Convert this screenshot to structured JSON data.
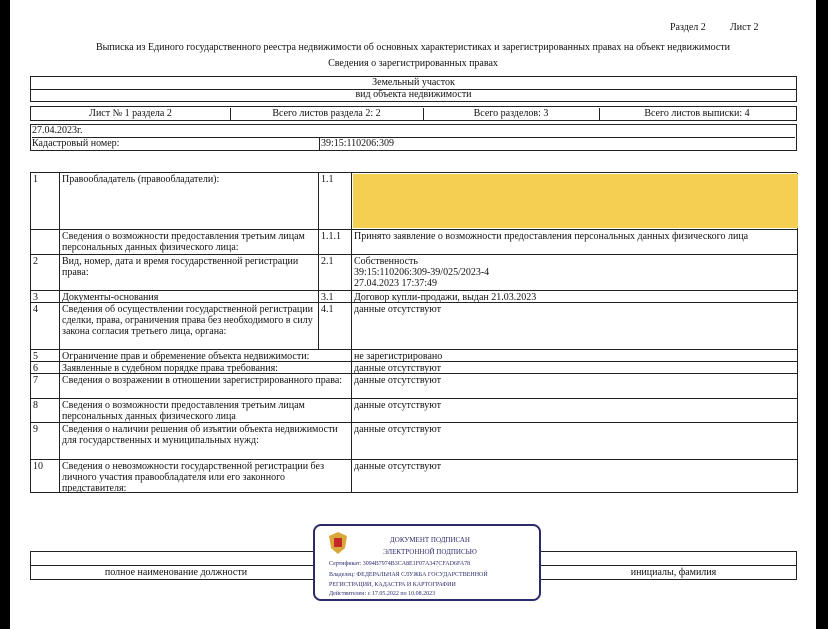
{
  "header": {
    "section": "Раздел 2",
    "sheet": "Лист 2",
    "title": "Выписка из Единого государственного реестра недвижимости об основных характеристиках и зарегистрированных правах на объект недвижимости",
    "subtitle": "Сведения о зарегистрированных правах"
  },
  "object": {
    "type": "Земельный участок",
    "type_caption": "вид объекта недвижимости"
  },
  "sheets": [
    "Лист № 1 раздела 2",
    "Всего листов раздела 2: 2",
    "Всего разделов: 3",
    "Всего листов выписки: 4"
  ],
  "date": "27.04.2023г.",
  "cadastral": {
    "label": "Кадастровый номер:",
    "value": "39:15:110206:309"
  },
  "rows": [
    {
      "num": "1",
      "label": "Правообладатель (правообладатели):",
      "code": "1.1",
      "value": ""
    },
    {
      "num": "",
      "label": "Сведения о возможности предоставления третьим лицам персональных данных физического лица:",
      "code": "1.1.1",
      "value": "Принято заявление о возможности предоставления персональных данных физического лица"
    },
    {
      "num": "2",
      "label": "Вид, номер, дата и время государственной регистрации права:",
      "code": "2.1",
      "value": "Собственность\n39:15:110206:309-39/025/2023-4\n27.04.2023 17:37:49"
    },
    {
      "num": "3",
      "label": "Документы-основания",
      "code": "3.1",
      "value": "Договор купли-продажи, выдан 21.03.2023"
    },
    {
      "num": "4",
      "label": "Сведения об осуществлении государственной регистрации сделки, права, ограничения права без необходимого в силу закона согласия третьего лица, органа:",
      "code": "4.1",
      "value": "данные отсутствуют"
    },
    {
      "num": "5",
      "label": "Ограничение прав и обременение объекта недвижимости:",
      "code": "",
      "value": "не зарегистрировано"
    },
    {
      "num": "6",
      "label": "Заявленные в судебном порядке права требования:",
      "code": "",
      "value": "данные отсутствуют"
    },
    {
      "num": "7",
      "label": "Сведения о возражении в отношении зарегистрированного права:",
      "code": "",
      "value": "данные отсутствуют"
    },
    {
      "num": "8",
      "label": "Сведения о возможности предоставления третьим лицам персональных данных физического лица",
      "code": "",
      "value": "данные отсутствуют"
    },
    {
      "num": "9",
      "label": "Сведения о наличии решения об изъятии объекта недвижимости для государственных и муниципальных нужд:",
      "code": "",
      "value": "данные отсутствуют"
    },
    {
      "num": "10",
      "label": "Сведения о невозможности государственной регистрации без личного участия правообладателя или его законного представителя:",
      "code": "",
      "value": "данные отсутствуют"
    }
  ],
  "footer": {
    "position": "полное наименование должности",
    "initials": "инициалы, фамилия"
  },
  "stamp": {
    "line1": "ДОКУМЕНТ ПОДПИСАН",
    "line2": "ЭЛЕКТРОННОЙ ПОДПИСЬЮ",
    "cert": "Сертификат: 3094B7974B3CA8E1F07A347CFAD6FA78",
    "owner": "Владелец: ФЕДЕРАЛЬНАЯ СЛУЖБА ГОСУДАРСТВЕННОЙ",
    "owner2": "РЕГИСТРАЦИИ, КАДАСТРА И КАРТОГРАФИИ",
    "valid": "Действителен: с 17.05.2022 по 10.08.2023"
  },
  "colors": {
    "redaction": "#f5cf52",
    "stamp": "#2b2a6b"
  }
}
